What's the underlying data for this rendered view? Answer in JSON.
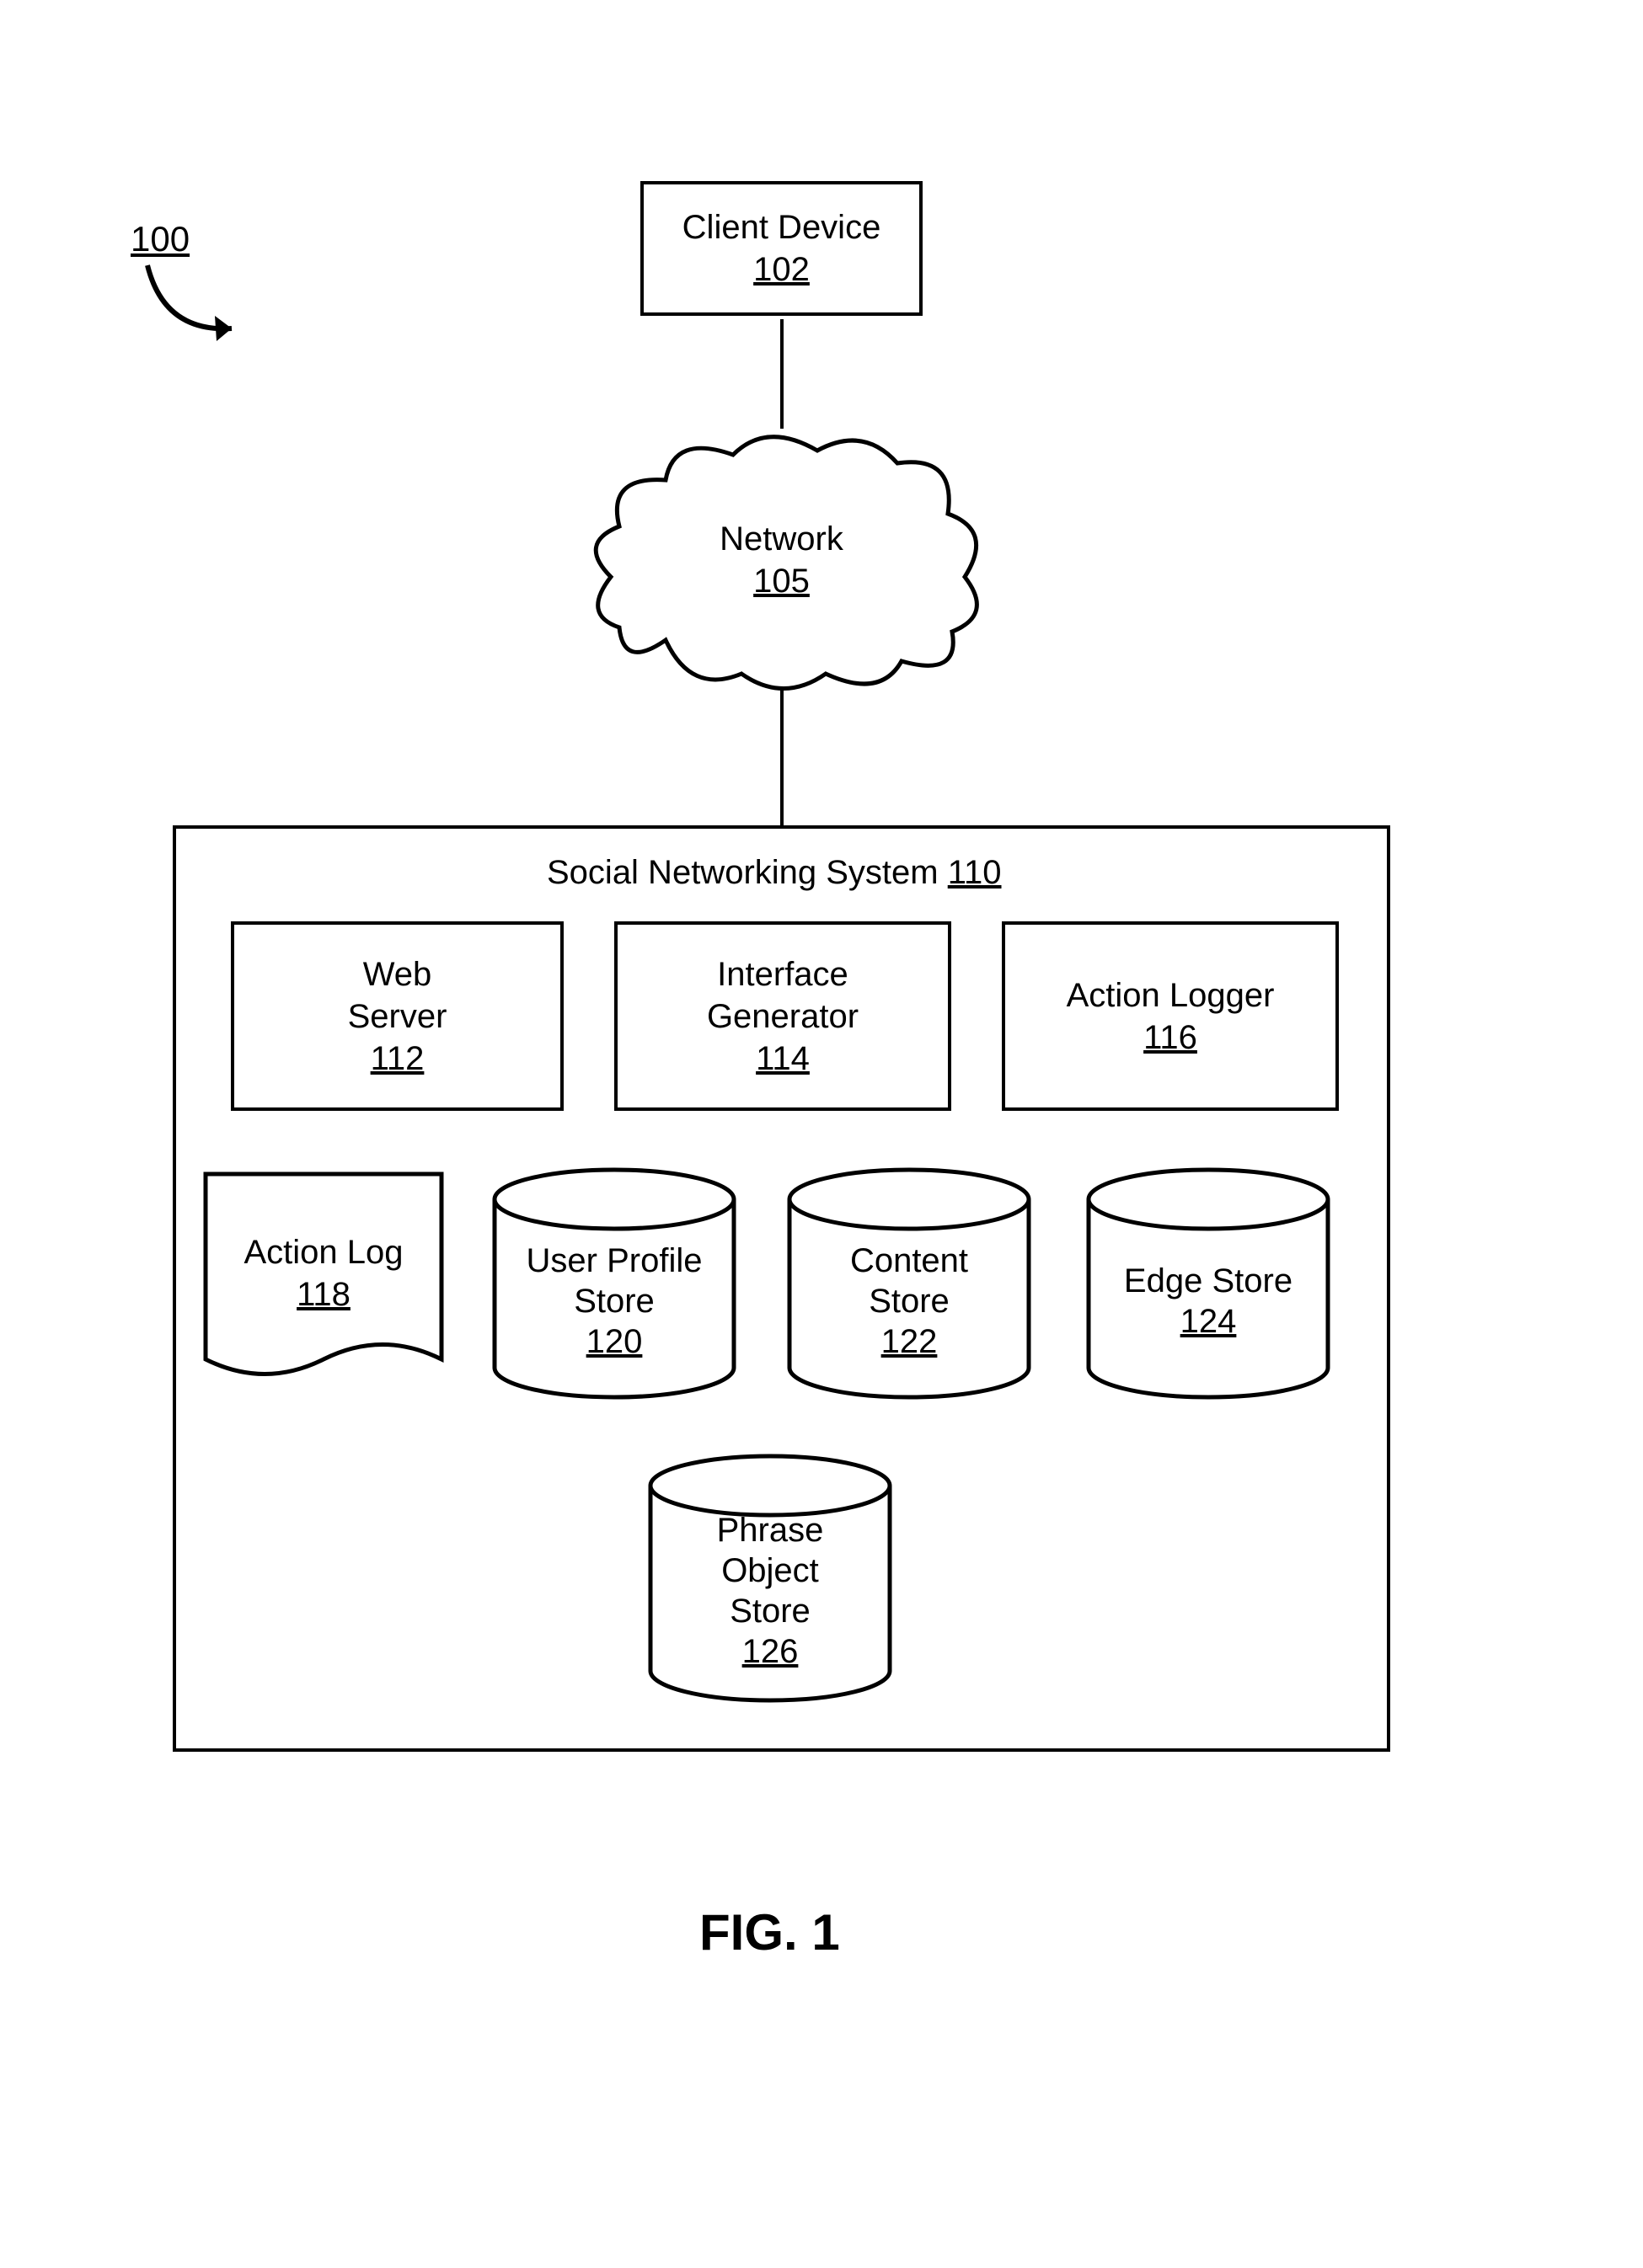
{
  "ref": "100",
  "client_device": {
    "label": "Client Device",
    "num": "102"
  },
  "network": {
    "label": "Network",
    "num": "105"
  },
  "system": {
    "label": "Social Networking System",
    "num": "110"
  },
  "web_server": {
    "label": "Web\nServer",
    "num": "112"
  },
  "interface_gen": {
    "label": "Interface\nGenerator",
    "num": "114"
  },
  "action_logger": {
    "label": "Action Logger",
    "num": "116"
  },
  "action_log": {
    "label": "Action Log",
    "num": "118"
  },
  "user_profile": {
    "label": "User Profile\nStore",
    "num": "120"
  },
  "content_store": {
    "label": "Content\nStore",
    "num": "122"
  },
  "edge_store": {
    "label": "Edge Store",
    "num": "124"
  },
  "phrase_store": {
    "label": "Phrase\nObject\nStore",
    "num": "126"
  },
  "figure": "FIG. 1"
}
